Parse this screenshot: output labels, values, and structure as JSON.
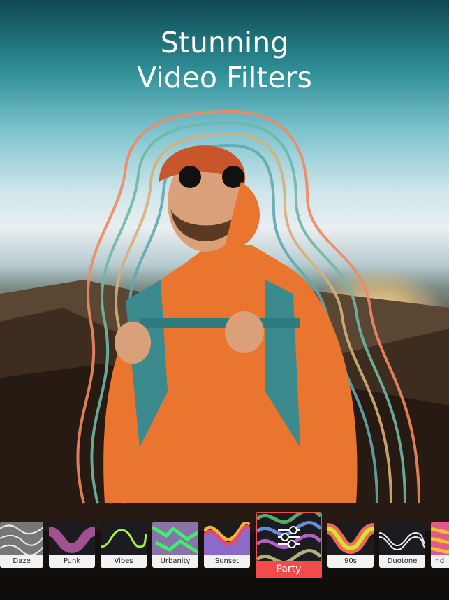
{
  "headline": {
    "line1": "Stunning",
    "line2": "Video Filters"
  },
  "filters": [
    {
      "label": "Daze",
      "icon": "texture-thumbnail"
    },
    {
      "label": "Punk",
      "icon": "wave-thumbnail"
    },
    {
      "label": "Vibes",
      "icon": "wave-thumbnail"
    },
    {
      "label": "Urbanity",
      "icon": "glitch-thumbnail"
    },
    {
      "label": "Sunset",
      "icon": "wave-thumbnail"
    },
    {
      "label": "Party",
      "icon": "sliders-icon",
      "selected": true
    },
    {
      "label": "90s",
      "icon": "wave-thumbnail"
    },
    {
      "label": "Duotone",
      "icon": "wave-thumbnail"
    },
    {
      "label": "Irid",
      "icon": "wave-thumbnail"
    }
  ],
  "colors": {
    "selected": "#f24b4b",
    "tile_label_bg": "#f2f2f2"
  }
}
